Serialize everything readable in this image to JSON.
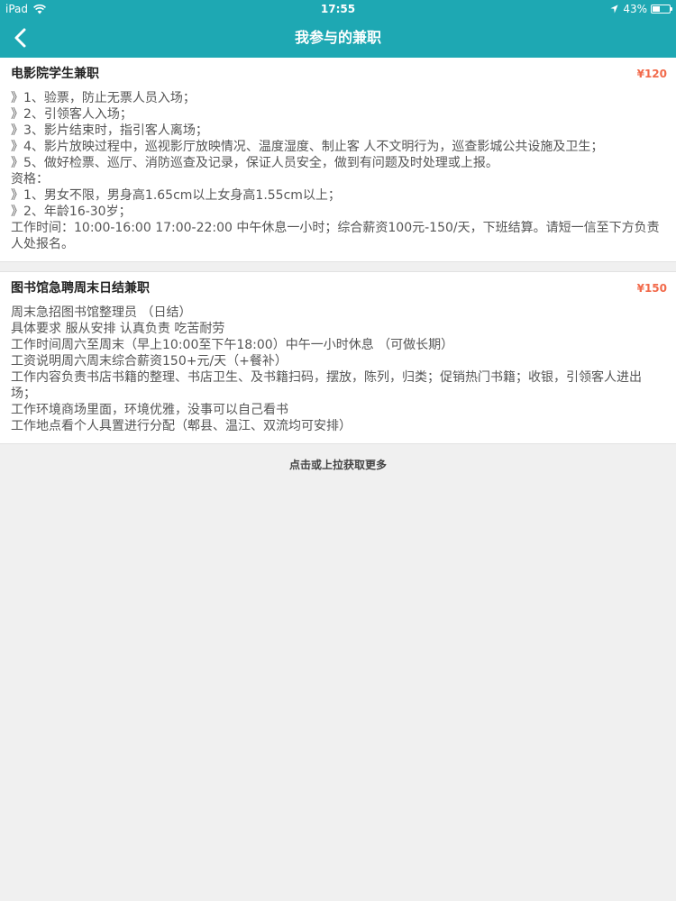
{
  "status_bar": {
    "device": "iPad",
    "time": "17:55",
    "battery": "43%",
    "battery_level": 0.43,
    "icons": [
      "wifi-icon",
      "location-icon",
      "battery-icon"
    ]
  },
  "nav": {
    "title": "我参与的兼职",
    "back_icon": "chevron-left-icon"
  },
  "jobs": [
    {
      "title": "电影院学生兼职",
      "price": "¥120",
      "description": "》1、验票，防止无票人员入场；\n》2、引领客人入场；\n》3、影片结束时，指引客人离场；\n》4、影片放映过程中，巡视影厅放映情况、温度湿度、制止客 人不文明行为，巡查影城公共设施及卫生；\n》5、做好检票、巡厅、消防巡查及记录，保证人员安全，做到有问题及时处理或上报。\n资格：\n》1、男女不限，男身高1.65cm以上女身高1.55cm以上；\n》2、年龄16-30岁；\n工作时间：10:00-16:00 17:00-22:00 中午休息一小时；综合薪资100元-150/天，下班结算。请短一信至下方负责人处报名。"
    },
    {
      "title": "图书馆急聘周末日结兼职",
      "price": "¥150",
      "description": "周末急招图书馆整理员 （日结）\n具体要求 服从安排 认真负责 吃苦耐劳\n工作时间周六至周末（早上10:00至下午18:00）中午一小时休息 （可做长期）\n工资说明周六周末综合薪资150+元/天（+餐补）\n工作内容负责书店书籍的整理、书店卫生、及书籍扫码，摆放，陈列，归类；促销热门书籍；收银，引领客人进出场；\n工作环境商场里面，环境优雅，没事可以自己看书\n工作地点看个人具置进行分配（郫县、温江、双流均可安排）"
    }
  ],
  "load_more": "点击或上拉获取更多",
  "colors": {
    "header": "#1ea8b3",
    "price": "#f26a4b",
    "background": "#f0f0f0"
  }
}
